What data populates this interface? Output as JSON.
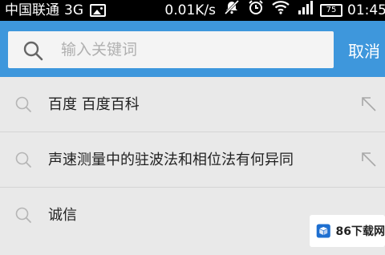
{
  "status_bar": {
    "carrier": "中国联通",
    "network": "3G",
    "speed": "0.01K/s",
    "battery": "75",
    "time": "01:45",
    "icons": [
      "image-icon",
      "mute-icon",
      "alarm-icon",
      "wifi-icon",
      "signal-icon",
      "battery-icon"
    ]
  },
  "search": {
    "placeholder": "输入关键词",
    "value": "",
    "cancel_label": "取消"
  },
  "history": [
    {
      "text": "百度  百度百科",
      "has_fill_arrow": true
    },
    {
      "text": "声速测量中的驻波法和相位法有何异同",
      "has_fill_arrow": true
    },
    {
      "text": "诚信",
      "has_fill_arrow": false
    }
  ],
  "watermark": {
    "text": "86下载网"
  },
  "colors": {
    "header": "#3e97dc",
    "list_bg": "#e9e9e9",
    "divider": "#d4d4d4"
  }
}
